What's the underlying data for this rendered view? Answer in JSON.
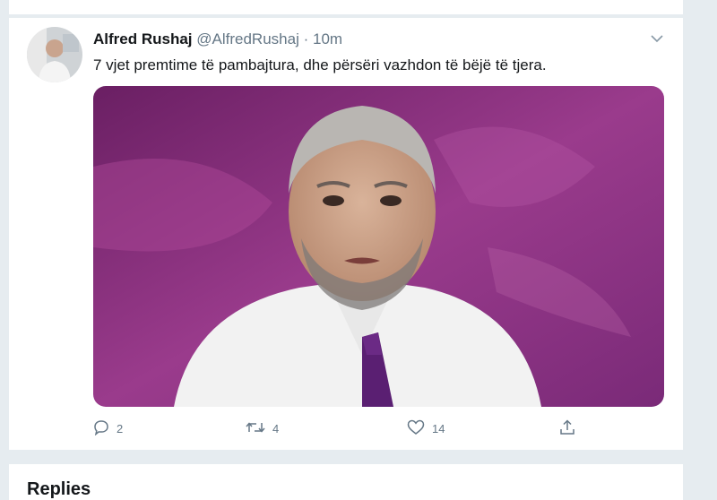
{
  "tweet": {
    "author_name": "Alfred Rushaj",
    "author_handle": "@AlfredRushaj",
    "separator": "·",
    "time": "10m",
    "text": "7 vjet premtime të pambajtura, dhe përsëri vazhdon të bëjë të tjera.",
    "counts": {
      "replies": "2",
      "retweets": "4",
      "likes": "14"
    }
  },
  "replies_section": {
    "title": "Replies"
  },
  "icons": {
    "caret": "chevron-down-icon",
    "reply": "reply-icon",
    "retweet": "retweet-icon",
    "like": "heart-icon",
    "share": "share-icon"
  },
  "colors": {
    "page_background": "#e6ecf0",
    "text_secondary": "#657786",
    "media_purple": "#8a2f8a"
  }
}
